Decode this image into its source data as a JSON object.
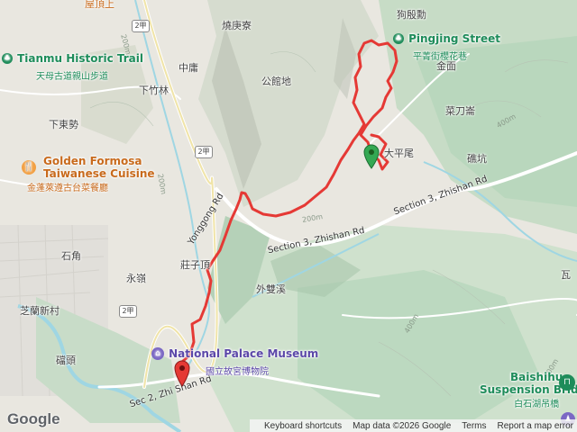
{
  "map": {
    "provider_logo": "Google",
    "colors": {
      "track": "#e53935",
      "park_green": "#bfe0c5",
      "water": "#9fd6e3",
      "poi_green": "#1e8c5a",
      "poi_orange": "#c86a1c",
      "poi_purple": "#5b47a8"
    },
    "places": [
      {
        "id": "youfu",
        "text": "屋頂上"
      },
      {
        "id": "shaoliao",
        "text": "燒庚寮"
      },
      {
        "id": "goudenshou",
        "text": "狗殷勳"
      },
      {
        "id": "zhongyong",
        "text": "中庸"
      },
      {
        "id": "gongguandi",
        "text": "公館地"
      },
      {
        "id": "jinmian",
        "text": "金面"
      },
      {
        "id": "xiazhulin",
        "text": "下竹林"
      },
      {
        "id": "xiadongshi",
        "text": "下東勢"
      },
      {
        "id": "cailunqi",
        "text": "菜刀崙"
      },
      {
        "id": "dapingwei",
        "text": "大平尾"
      },
      {
        "id": "bikeng",
        "text": "礁坑"
      },
      {
        "id": "shijiao",
        "text": "石角"
      },
      {
        "id": "yongling",
        "text": "永嶺"
      },
      {
        "id": "zhuangzi",
        "text": "莊子頂"
      },
      {
        "id": "waishuangxi",
        "text": "外雙溪"
      },
      {
        "id": "zhilan",
        "text": "芝蘭新村"
      },
      {
        "id": "xitou",
        "text": "礑頭"
      },
      {
        "id": "walin",
        "text": "瓦"
      }
    ],
    "roads": [
      {
        "id": "yonggong",
        "text": "Yonggong Rd"
      },
      {
        "id": "zhishan3a",
        "text": "Section 3, Zhishan Rd"
      },
      {
        "id": "zhishan3b",
        "text": "Section 3, Zhishan Rd"
      },
      {
        "id": "zhishan2",
        "text": "Sec 2, Zhi Shan Rd"
      }
    ],
    "shields": [
      "2甲",
      "2甲",
      "2甲"
    ],
    "elevations": [
      "200m",
      "200m",
      "400m",
      "400m",
      "400m",
      "200m"
    ],
    "pois": [
      {
        "id": "tianmu",
        "name_en": "Tianmu Historic Trail",
        "name_zh": "天母古道親山步道",
        "color": "green",
        "icon": "park-icon"
      },
      {
        "id": "pingjing",
        "name_en": "Pingjing Street",
        "name_zh": "平菁街櫻花巷",
        "color": "green",
        "icon": "park-icon"
      },
      {
        "id": "golden",
        "name_en": "Golden Formosa",
        "name_en2": "Taiwanese Cuisine",
        "name_zh": "金蓬萊遵古台菜餐廳",
        "color": "orange",
        "icon": "restaurant-icon"
      },
      {
        "id": "museum",
        "name_en": "National Palace Museum",
        "name_zh": "國立故宮博物院",
        "color": "purple",
        "icon": "museum-icon"
      },
      {
        "id": "baishihu",
        "name_en": "Baishihu",
        "name_en2": "Suspension Bridge",
        "name_zh": "白石湖吊橋",
        "color": "green",
        "icon": "bridge-icon"
      }
    ],
    "markers": [
      {
        "id": "start",
        "icon": "red-pin-icon"
      },
      {
        "id": "waypoint",
        "icon": "green-pin-icon"
      }
    ],
    "attribution": {
      "keyboard": "Keyboard shortcuts",
      "data": "Map data ©2026 Google",
      "terms": "Terms",
      "report": "Report a map error"
    }
  }
}
